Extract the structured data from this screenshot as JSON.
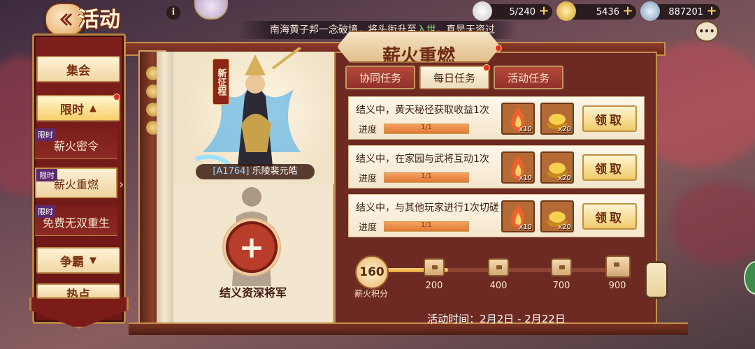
{
  "top_bar": {
    "title": "活动",
    "resources": [
      {
        "icon": "rice-bun-icon",
        "value": "5/240"
      },
      {
        "icon": "gold-ingot-icon",
        "value": "5436"
      },
      {
        "icon": "silver-coin-icon",
        "value": "887201"
      }
    ],
    "ticker": {
      "text_before": "南海黄子邦一念破境，将头衔升至",
      "highlight": "入世",
      "text_after": "，真是天资过"
    }
  },
  "sidebar": {
    "items": [
      {
        "label": "集会"
      },
      {
        "label": "限时",
        "arrow": "▲"
      },
      {
        "label": "薪火密令",
        "tag": "限时"
      },
      {
        "label": "薪火重燃",
        "tag": "限时"
      },
      {
        "label": "免费无双重生",
        "tag": "限时"
      },
      {
        "label": "争霸",
        "arrow": "▼"
      },
      {
        "label": "热点"
      }
    ]
  },
  "panel_title": "薪火重燃",
  "hero": {
    "badge": "新征程",
    "code": "[A1764]",
    "name": "乐陵裴元皓"
  },
  "recruit": {
    "label": "结义资深将军"
  },
  "tabs": [
    {
      "label": "协同任务",
      "active": false
    },
    {
      "label": "每日任务",
      "active": true
    },
    {
      "label": "活动任务",
      "active": false
    }
  ],
  "tasks": [
    {
      "desc": "结义中，黄天秘径获取收益1次",
      "progress_label": "进度",
      "progress_text": "1/1",
      "progress": 1.0,
      "rewards": [
        {
          "icon": "fire-icon",
          "qty": "x10"
        },
        {
          "icon": "gold-ingot-icon",
          "qty": "x20"
        }
      ],
      "button": "领取"
    },
    {
      "desc": "结义中，在家园与武将互动1次",
      "progress_label": "进度",
      "progress_text": "1/1",
      "progress": 1.0,
      "rewards": [
        {
          "icon": "fire-icon",
          "qty": "x10"
        },
        {
          "icon": "gold-ingot-icon",
          "qty": "x20"
        }
      ],
      "button": "领取"
    },
    {
      "desc": "结义中，与其他玩家进行1次切磋",
      "progress_label": "进度",
      "progress_text": "1/1",
      "progress": 1.0,
      "rewards": [
        {
          "icon": "fire-icon",
          "qty": "x10"
        },
        {
          "icon": "gold-ingot-icon",
          "qty": "x20"
        }
      ],
      "button": "领取"
    }
  ],
  "score": {
    "value": "160",
    "label": "薪火积分",
    "progress": 0.27,
    "milestones": [
      "200",
      "400",
      "700",
      "900"
    ]
  },
  "event_time": "活动时间：2月2日 - 2月22日",
  "colors": {
    "accent_red": "#7d1f1c",
    "gold": "#c48f4c",
    "cream": "#f3e6cf"
  }
}
